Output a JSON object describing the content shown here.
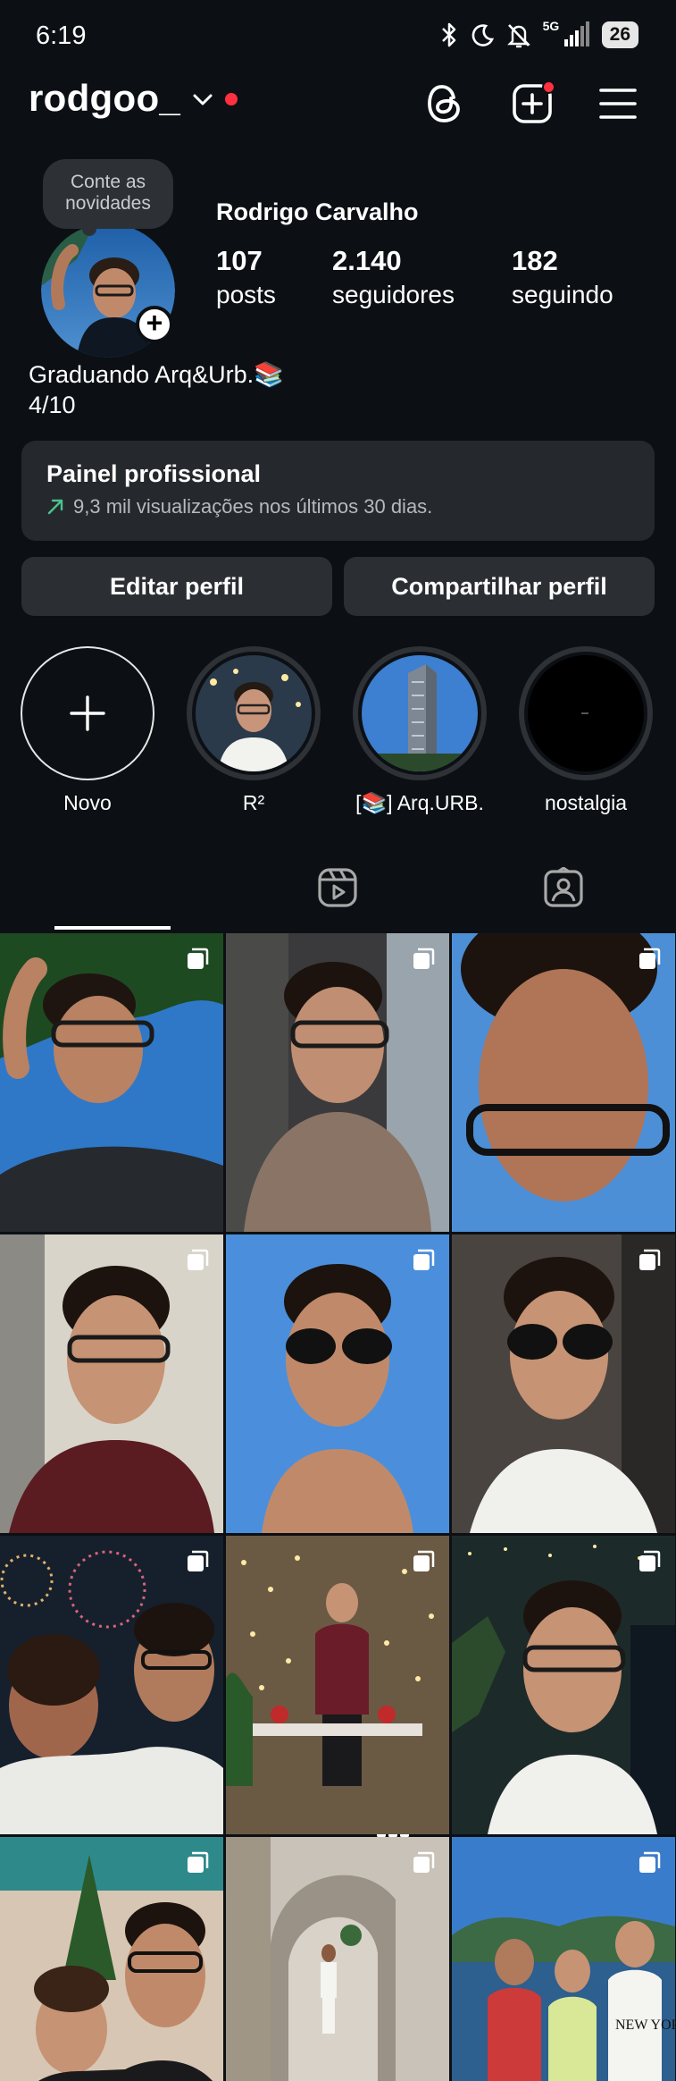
{
  "status_bar": {
    "time": "6:19",
    "network": "5G",
    "battery": "26",
    "icons": [
      "bluetooth-icon",
      "moon-icon",
      "bell-off-icon",
      "signal-icon"
    ]
  },
  "header": {
    "username": "rodgoo_",
    "icons": [
      "chevron-down-icon",
      "threads-icon",
      "create-icon",
      "menu-icon"
    ]
  },
  "profile": {
    "note": "Conte as novidades",
    "display_name": "Rodrigo Carvalho",
    "stats": {
      "posts_count": "107",
      "posts_label": "posts",
      "followers_count": "2.140",
      "followers_label": "seguidores",
      "following_count": "182",
      "following_label": "seguindo"
    },
    "bio_line1": "Graduando Arq&Urb.📚",
    "bio_line2": "4/10"
  },
  "pro_panel": {
    "title": "Painel profissional",
    "subtitle": "9,3 mil visualizações nos últimos 30 dias."
  },
  "buttons": {
    "edit": "Editar perfil",
    "share": "Compartilhar perfil"
  },
  "highlights": [
    {
      "label": "Novo"
    },
    {
      "label": "R²"
    },
    {
      "label": "[📚] Arq.URB."
    },
    {
      "label": "nostalgia"
    }
  ],
  "tabs": [
    "grid-icon",
    "reels-icon",
    "tagged-icon"
  ],
  "colors": {
    "background": "#0c1014",
    "card": "#25292e",
    "button": "#2b2f34",
    "notification": "#ff3040",
    "trend_green": "#4cc38a"
  },
  "grid_posts": 12
}
